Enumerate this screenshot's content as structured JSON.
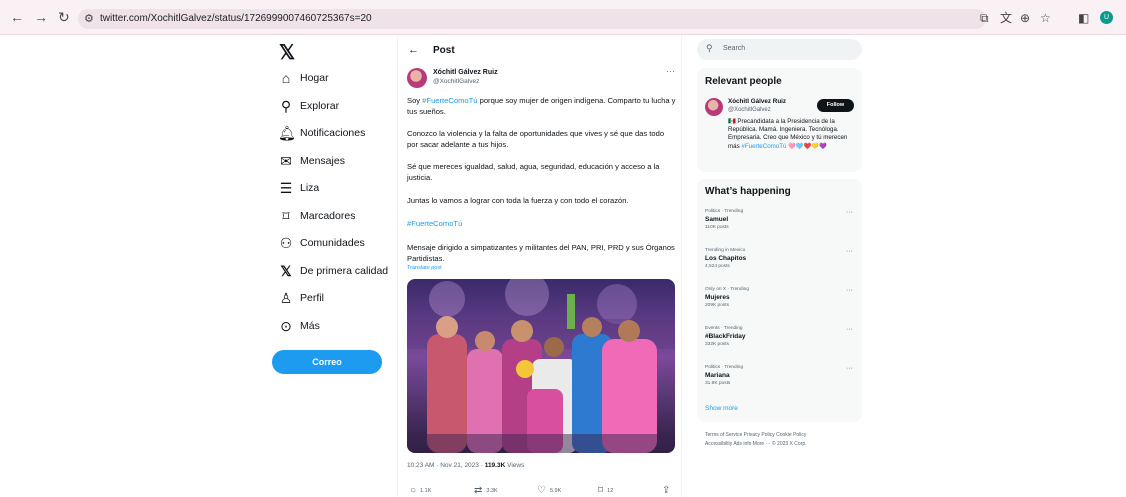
{
  "browser": {
    "url": "twitter.com/XochitlGalvez/status/1726999007460725367s=20",
    "profile_initial": "U"
  },
  "nav": {
    "items": [
      {
        "label": "Hogar",
        "icon": "home-icon"
      },
      {
        "label": "Explorar",
        "icon": "search-icon"
      },
      {
        "label": "Notificaciones",
        "icon": "bell-icon"
      },
      {
        "label": "Mensajes",
        "icon": "mail-icon"
      },
      {
        "label": "Liza",
        "icon": "list-icon"
      },
      {
        "label": "Marcadores",
        "icon": "bookmark-icon"
      },
      {
        "label": "Comunidades",
        "icon": "people-icon"
      },
      {
        "label": "De primera calidad",
        "icon": "x-logo-icon"
      },
      {
        "label": "Perfil",
        "icon": "person-icon"
      },
      {
        "label": "Más",
        "icon": "more-circle-icon"
      }
    ],
    "post_button": "Correo"
  },
  "post": {
    "header_title": "Post",
    "author_name": "Xóchitl Gálvez Ruiz",
    "author_handle": "@XochitlGalvez",
    "para1_a": "Soy ",
    "para1_tag": "#FuerteComoTú",
    "para1_b": " porque soy mujer de origen indígena. Comparto tu lucha y tus sueños.",
    "para2": "Conozco la violencia y la falta de oportunidades que vives y sé que das todo por sacar adelante a tus hijos.",
    "para3": "Sé que mereces igualdad, salud, agua, seguridad, educación y acceso a la justicia.",
    "para4": "Juntas lo vamos a lograr con toda la fuerza y con todo el corazón.",
    "hashtag": "#FuerteComoTú",
    "para5": "Mensaje dirigido a simpatizantes y militantes del PAN, PRI, PRD y sus Órganos Partidistas.",
    "translate": "Translate post",
    "time": "10:23 AM · Nov 21, 2023 · ",
    "views_count": "119.3K",
    "views_label": " Views",
    "replies": "1.1K",
    "reposts": "3.3K",
    "likes": "5.9K",
    "bookmarks": "12"
  },
  "search": {
    "placeholder": "Search"
  },
  "relevant": {
    "title": "Relevant people",
    "name": "Xóchitl Gálvez Ruiz",
    "handle": "@XochitlGalvez",
    "follow": "Follow",
    "bio_a": "🇲🇽 Precandidata a la Presidencia de la República. Mamá. Ingeniera. Tecnóloga. Empresaria. Creo que México y tú merecen más ",
    "bio_tag": "#FuerteComoTú",
    "bio_emoji": " 🩷🩵❤️💛💜"
  },
  "happening": {
    "title": "What’s happening",
    "trends": [
      {
        "context": "Politics · Trending",
        "name": "Samuel",
        "count": "110K posts"
      },
      {
        "context": "Trending in Mexico",
        "name": "Los Chapitos",
        "count": "4,524 posts"
      },
      {
        "context": "Only on X · Trending",
        "name": "Mujeres",
        "count": "209K posts"
      },
      {
        "context": "Events · Trending",
        "name": "#BlackFriday",
        "count": "332K posts"
      },
      {
        "context": "Politics · Trending",
        "name": "Mariana",
        "count": "31.9K posts"
      }
    ],
    "show_more": "Show more"
  },
  "footer": {
    "line1": "Terms of Service   Privacy Policy   Cookie Policy",
    "line2": "Accessibility   Ads info   More ···   © 2023 X Corp."
  }
}
